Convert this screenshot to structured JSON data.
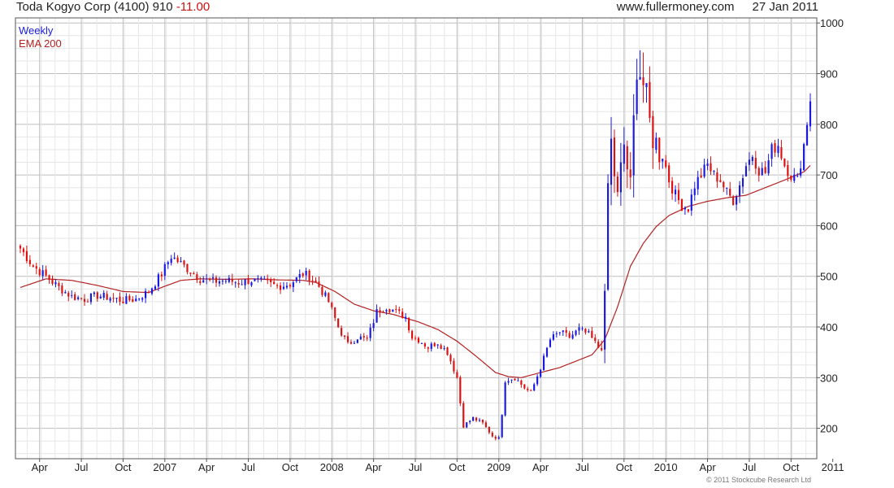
{
  "header": {
    "title": "Toda Kogyo Corp (4100)",
    "last": "910",
    "change": "-11.00",
    "site": "www.fullermoney.com",
    "date": "27 Jan 2011"
  },
  "copyright": "© 2011 Stockcube Research Ltd",
  "chart_data": {
    "type": "candlestick",
    "period": "Weekly",
    "grid": true,
    "y_axis_position": "right",
    "ylim": [
      140,
      1010
    ],
    "y_ticks": [
      200,
      300,
      400,
      500,
      600,
      700,
      800,
      900,
      1000
    ],
    "x_range": [
      0,
      246
    ],
    "x_ticks": [
      {
        "label": "Apr",
        "week": 6
      },
      {
        "label": "Jul",
        "week": 19
      },
      {
        "label": "Oct",
        "week": 32
      },
      {
        "label": "2007",
        "week": 45
      },
      {
        "label": "Apr",
        "week": 58
      },
      {
        "label": "Jul",
        "week": 71
      },
      {
        "label": "Oct",
        "week": 84
      },
      {
        "label": "2008",
        "week": 97
      },
      {
        "label": "Apr",
        "week": 110
      },
      {
        "label": "Jul",
        "week": 123
      },
      {
        "label": "Oct",
        "week": 136
      },
      {
        "label": "2009",
        "week": 149
      },
      {
        "label": "Apr",
        "week": 162
      },
      {
        "label": "Jul",
        "week": 175
      },
      {
        "label": "Oct",
        "week": 188
      },
      {
        "label": "2010",
        "week": 201
      },
      {
        "label": "Apr",
        "week": 214
      },
      {
        "label": "Jul",
        "week": 227
      },
      {
        "label": "Oct",
        "week": 240
      },
      {
        "label": "2011",
        "week": 253
      }
    ],
    "colors": {
      "up": "#1a1adf",
      "down": "#dd1111",
      "ema": "#b22222",
      "grid": "#d6d6d6"
    },
    "legend": [
      {
        "name": "Weekly",
        "color": "#1a1adf"
      },
      {
        "name": "EMA 200",
        "color": "#b22222"
      }
    ],
    "close_anchors": [
      [
        0,
        555
      ],
      [
        4,
        520
      ],
      [
        8,
        500
      ],
      [
        12,
        478
      ],
      [
        16,
        460
      ],
      [
        20,
        455
      ],
      [
        24,
        462
      ],
      [
        28,
        458
      ],
      [
        32,
        452
      ],
      [
        36,
        455
      ],
      [
        40,
        470
      ],
      [
        44,
        505
      ],
      [
        47,
        540
      ],
      [
        50,
        525
      ],
      [
        53,
        510
      ],
      [
        56,
        495
      ],
      [
        60,
        490
      ],
      [
        64,
        492
      ],
      [
        68,
        488
      ],
      [
        72,
        492
      ],
      [
        76,
        488
      ],
      [
        80,
        480
      ],
      [
        84,
        485
      ],
      [
        88,
        505
      ],
      [
        90,
        500
      ],
      [
        93,
        480
      ],
      [
        96,
        450
      ],
      [
        99,
        400
      ],
      [
        102,
        365
      ],
      [
        105,
        380
      ],
      [
        108,
        375
      ],
      [
        111,
        430
      ],
      [
        114,
        440
      ],
      [
        117,
        430
      ],
      [
        120,
        420
      ],
      [
        122,
        380
      ],
      [
        124,
        375
      ],
      [
        127,
        360
      ],
      [
        130,
        370
      ],
      [
        133,
        350
      ],
      [
        136,
        300
      ],
      [
        137,
        250
      ],
      [
        138,
        205
      ],
      [
        141,
        220
      ],
      [
        144,
        210
      ],
      [
        147,
        185
      ],
      [
        149,
        180
      ],
      [
        150,
        230
      ],
      [
        151,
        295
      ],
      [
        154,
        300
      ],
      [
        157,
        280
      ],
      [
        159,
        270
      ],
      [
        162,
        320
      ],
      [
        165,
        375
      ],
      [
        168,
        390
      ],
      [
        171,
        380
      ],
      [
        174,
        395
      ],
      [
        177,
        385
      ],
      [
        180,
        360
      ],
      [
        181,
        370
      ],
      [
        182,
        450
      ],
      [
        183,
        680
      ],
      [
        184,
        760
      ],
      [
        186,
        650
      ],
      [
        188,
        760
      ],
      [
        190,
        670
      ],
      [
        192,
        930
      ],
      [
        194,
        880
      ],
      [
        196,
        800
      ],
      [
        198,
        760
      ],
      [
        200,
        740
      ],
      [
        202,
        690
      ],
      [
        204,
        660
      ],
      [
        206,
        640
      ],
      [
        208,
        635
      ],
      [
        210,
        680
      ],
      [
        212,
        700
      ],
      [
        214,
        720
      ],
      [
        216,
        700
      ],
      [
        218,
        690
      ],
      [
        220,
        665
      ],
      [
        222,
        650
      ],
      [
        224,
        680
      ],
      [
        226,
        720
      ],
      [
        228,
        740
      ],
      [
        230,
        710
      ],
      [
        232,
        705
      ],
      [
        234,
        750
      ],
      [
        236,
        760
      ],
      [
        238,
        720
      ],
      [
        240,
        700
      ],
      [
        242,
        690
      ],
      [
        244,
        760
      ],
      [
        246,
        850
      ],
      [
        247,
        900
      ],
      [
        248,
        880
      ],
      [
        249,
        870
      ]
    ],
    "ema_points": [
      [
        0,
        478
      ],
      [
        8,
        495
      ],
      [
        16,
        492
      ],
      [
        24,
        482
      ],
      [
        32,
        470
      ],
      [
        40,
        468
      ],
      [
        44,
        478
      ],
      [
        50,
        492
      ],
      [
        56,
        495
      ],
      [
        64,
        494
      ],
      [
        72,
        495
      ],
      [
        80,
        493
      ],
      [
        88,
        492
      ],
      [
        92,
        488
      ],
      [
        98,
        470
      ],
      [
        104,
        445
      ],
      [
        110,
        432
      ],
      [
        116,
        425
      ],
      [
        124,
        410
      ],
      [
        130,
        395
      ],
      [
        136,
        372
      ],
      [
        142,
        342
      ],
      [
        148,
        310
      ],
      [
        152,
        302
      ],
      [
        156,
        300
      ],
      [
        162,
        310
      ],
      [
        168,
        320
      ],
      [
        174,
        335
      ],
      [
        178,
        345
      ],
      [
        182,
        375
      ],
      [
        186,
        440
      ],
      [
        190,
        520
      ],
      [
        194,
        565
      ],
      [
        198,
        598
      ],
      [
        202,
        620
      ],
      [
        208,
        638
      ],
      [
        214,
        648
      ],
      [
        220,
        655
      ],
      [
        226,
        660
      ],
      [
        232,
        675
      ],
      [
        238,
        690
      ],
      [
        244,
        706
      ],
      [
        249,
        738
      ]
    ]
  }
}
